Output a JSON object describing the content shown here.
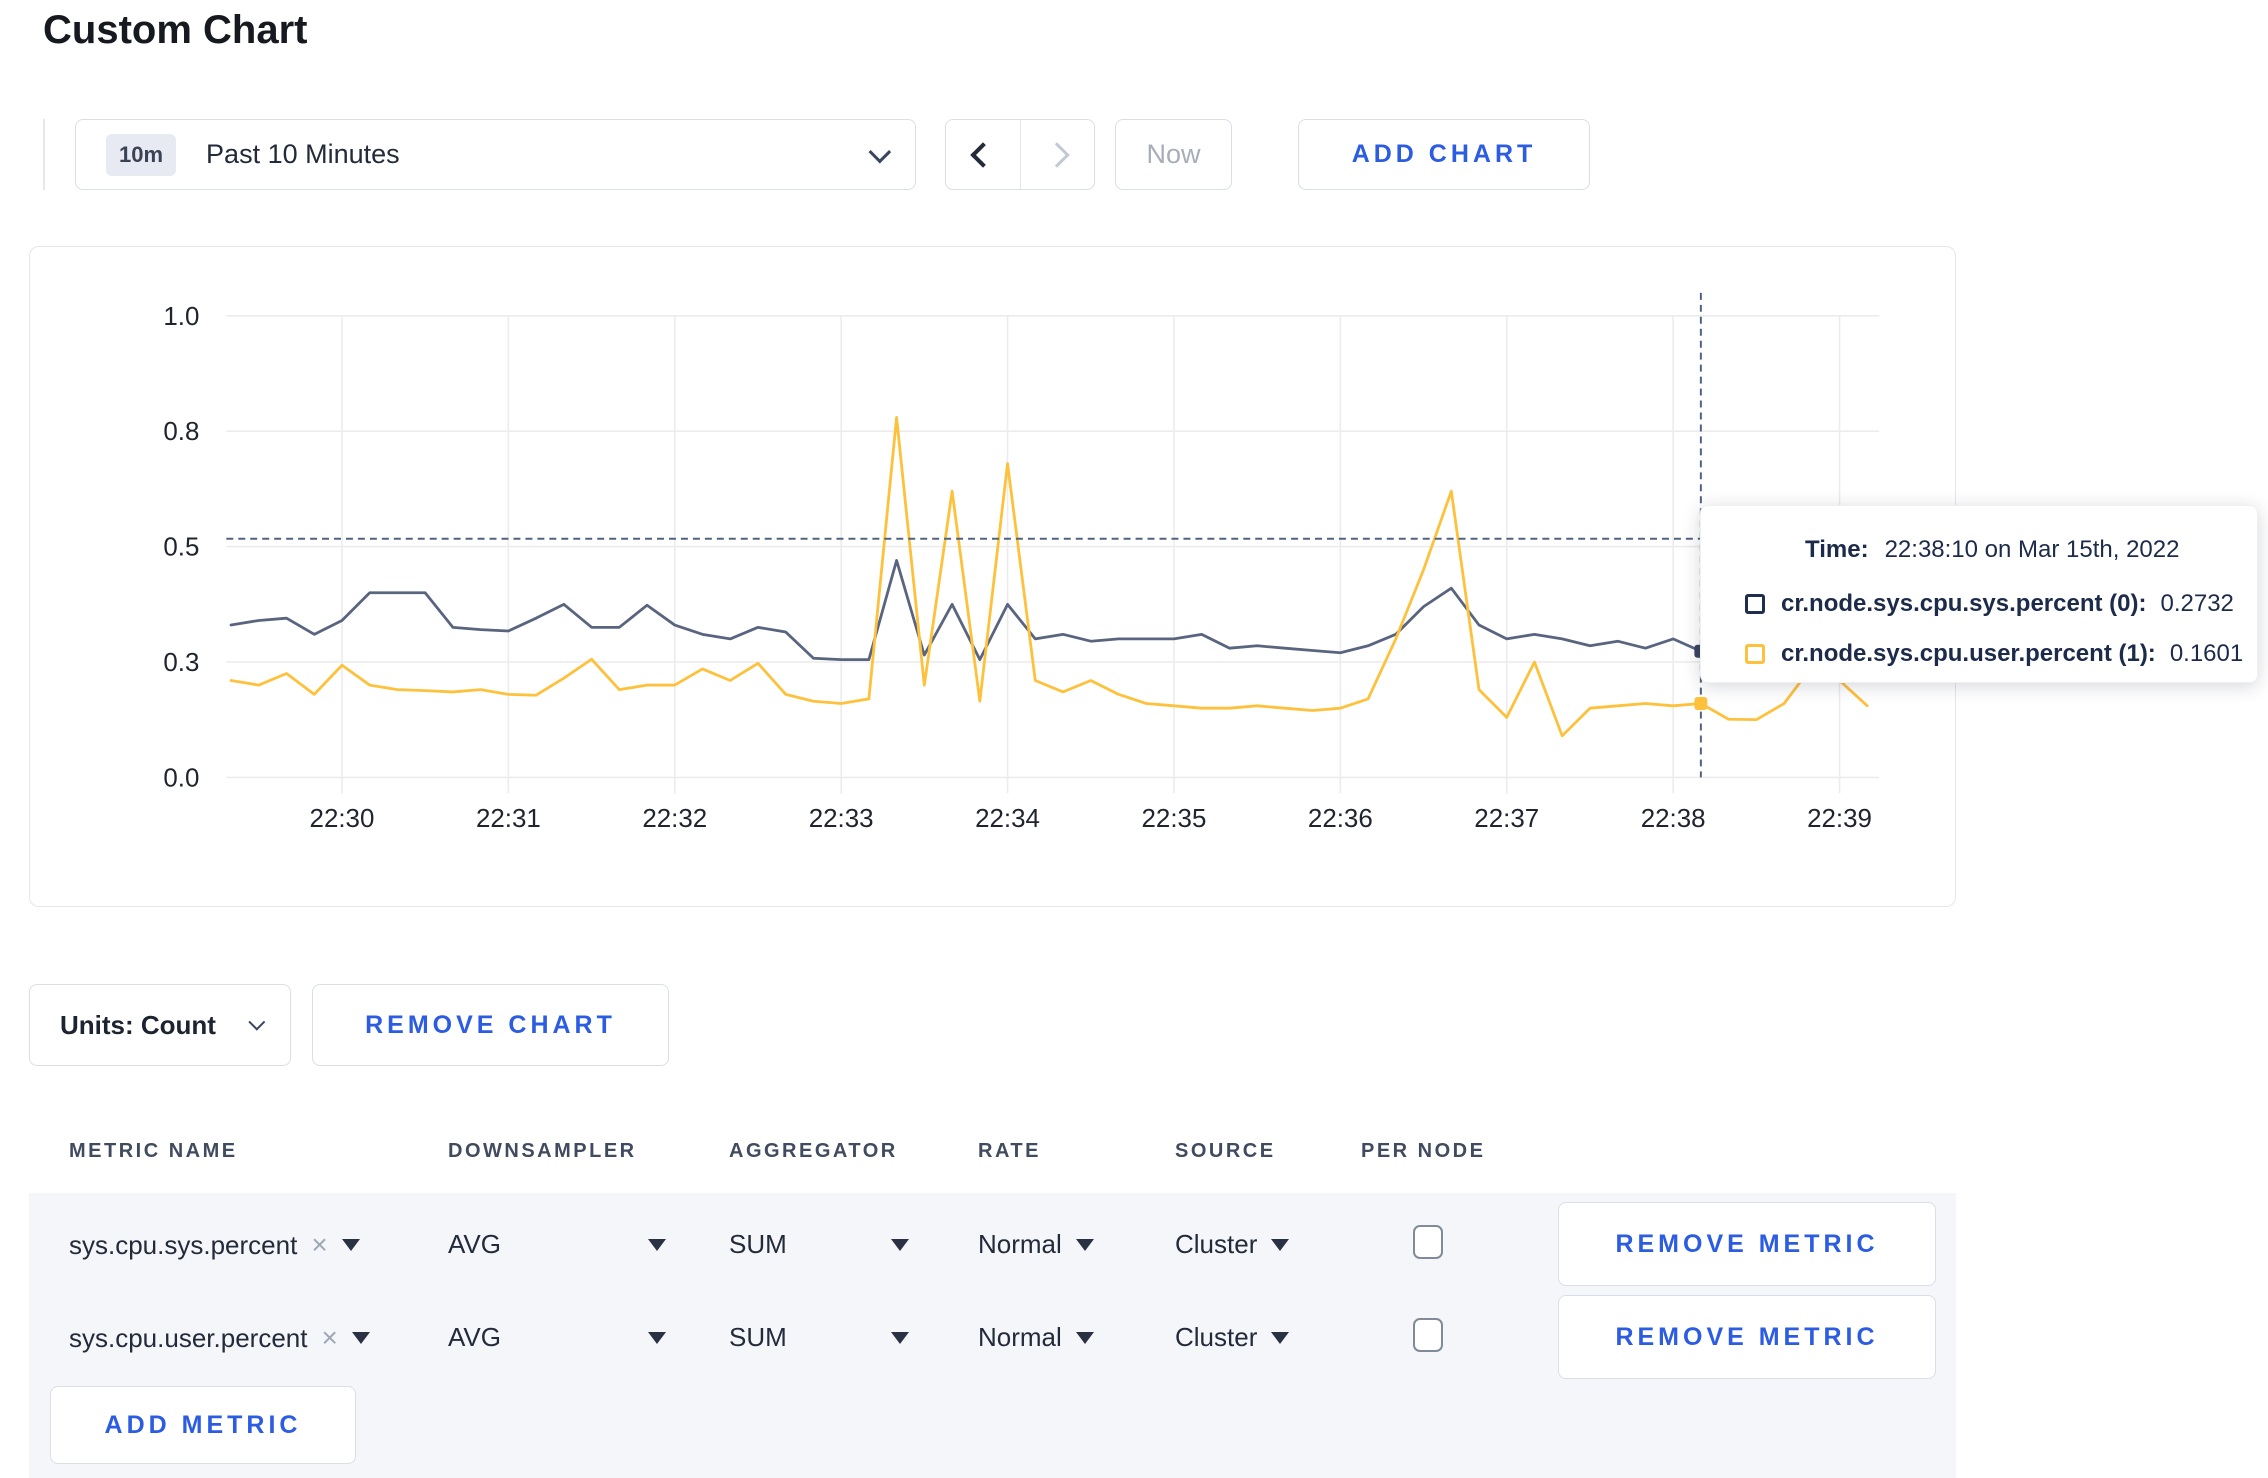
{
  "page": {
    "title": "Custom Chart"
  },
  "toolbar": {
    "time_badge": "10m",
    "time_label": "Past 10 Minutes",
    "now_label": "Now",
    "add_chart_label": "ADD CHART"
  },
  "colors": {
    "accent_blue": "#2b5ce2",
    "series_sys": "#59647f",
    "series_user": "#fdc13c",
    "swatch_sys": "#1f2d4e",
    "swatch_user": "#fdc13c",
    "dot_sys": "#39455f",
    "dot_user": "#fdc13c",
    "gridline": "#ececec",
    "crosshair": "#51637e"
  },
  "chart_data": {
    "type": "line",
    "title": "",
    "xlabel": "",
    "ylabel": "",
    "grid": true,
    "ylim": [
      0,
      1
    ],
    "yticks": [
      {
        "v": 0.0,
        "label": "0.0"
      },
      {
        "v": 0.25,
        "label": "0.3"
      },
      {
        "v": 0.5,
        "label": "0.5"
      },
      {
        "v": 0.75,
        "label": "0.8"
      },
      {
        "v": 1.0,
        "label": "1.0"
      }
    ],
    "xticks": [
      "22:30",
      "22:31",
      "22:32",
      "22:33",
      "22:34",
      "22:35",
      "22:36",
      "22:37",
      "22:38",
      "22:39"
    ],
    "x": [
      "22:29:20",
      "22:29:30",
      "22:29:40",
      "22:29:50",
      "22:30:00",
      "22:30:10",
      "22:30:20",
      "22:30:30",
      "22:30:40",
      "22:30:50",
      "22:31:00",
      "22:31:10",
      "22:31:20",
      "22:31:30",
      "22:31:40",
      "22:31:50",
      "22:32:00",
      "22:32:10",
      "22:32:20",
      "22:32:30",
      "22:32:40",
      "22:32:50",
      "22:33:00",
      "22:33:10",
      "22:33:20",
      "22:33:30",
      "22:33:40",
      "22:33:50",
      "22:34:00",
      "22:34:10",
      "22:34:20",
      "22:34:30",
      "22:34:40",
      "22:34:50",
      "22:35:00",
      "22:35:10",
      "22:35:20",
      "22:35:30",
      "22:35:40",
      "22:35:50",
      "22:36:00",
      "22:36:10",
      "22:36:20",
      "22:36:30",
      "22:36:40",
      "22:36:50",
      "22:37:00",
      "22:37:10",
      "22:37:20",
      "22:37:30",
      "22:37:40",
      "22:37:50",
      "22:38:00",
      "22:38:10",
      "22:38:20",
      "22:38:30",
      "22:38:40",
      "22:38:50",
      "22:39:00",
      "22:39:10"
    ],
    "series": [
      {
        "name": "cr.node.sys.cpu.sys.percent (0)",
        "color": "#59647f",
        "values": [
          0.33,
          0.34,
          0.345,
          0.31,
          0.34,
          0.4,
          0.4,
          0.4,
          0.325,
          0.32,
          0.317,
          0.345,
          0.375,
          0.325,
          0.325,
          0.373,
          0.33,
          0.31,
          0.3,
          0.325,
          0.315,
          0.258,
          0.255,
          0.255,
          0.47,
          0.265,
          0.375,
          0.255,
          0.375,
          0.3,
          0.31,
          0.295,
          0.3,
          0.3,
          0.3,
          0.31,
          0.28,
          0.285,
          0.28,
          0.275,
          0.27,
          0.285,
          0.31,
          0.37,
          0.41,
          0.33,
          0.3,
          0.31,
          0.3,
          0.285,
          0.295,
          0.28,
          0.3,
          0.2732,
          0.28,
          0.285,
          0.29,
          0.3,
          0.305,
          0.3
        ]
      },
      {
        "name": "cr.node.sys.cpu.user.percent (1)",
        "color": "#fdc13c",
        "values": [
          0.21,
          0.2,
          0.225,
          0.18,
          0.243,
          0.2,
          0.19,
          0.188,
          0.185,
          0.19,
          0.18,
          0.178,
          0.215,
          0.256,
          0.19,
          0.2,
          0.2,
          0.235,
          0.21,
          0.247,
          0.18,
          0.165,
          0.16,
          0.17,
          0.78,
          0.2,
          0.62,
          0.165,
          0.68,
          0.21,
          0.185,
          0.21,
          0.18,
          0.16,
          0.155,
          0.15,
          0.15,
          0.155,
          0.15,
          0.145,
          0.15,
          0.17,
          0.3,
          0.45,
          0.62,
          0.19,
          0.13,
          0.25,
          0.09,
          0.15,
          0.155,
          0.16,
          0.155,
          0.1601,
          0.126,
          0.125,
          0.16,
          0.24,
          0.21,
          0.155
        ]
      }
    ],
    "crosshair": {
      "time": "22:38:10",
      "y_value": 0.517,
      "points": [
        {
          "v": 0.2732,
          "color": "#39455f"
        },
        {
          "v": 0.1601,
          "color": "#fdc13c"
        }
      ]
    }
  },
  "tooltip": {
    "time_label": "Time:",
    "time_value": "22:38:10 on Mar 15th, 2022",
    "series": [
      {
        "label": "cr.node.sys.cpu.sys.percent (0):",
        "value": "0.2732",
        "swatch": "#1f2d4e"
      },
      {
        "label": "cr.node.sys.cpu.user.percent (1):",
        "value": "0.1601",
        "swatch": "#fdc13c"
      }
    ]
  },
  "controls": {
    "units_label": "Units: Count",
    "remove_chart_label": "REMOVE CHART"
  },
  "metrics_table": {
    "headers": [
      "METRIC NAME",
      "DOWNSAMPLER",
      "AGGREGATOR",
      "RATE",
      "SOURCE",
      "PER NODE"
    ],
    "clear_icon": "×",
    "rows": [
      {
        "metric": "sys.cpu.sys.percent",
        "downsampler": "AVG",
        "aggregator": "SUM",
        "rate": "Normal",
        "source": "Cluster",
        "per_node_checked": false,
        "remove_label": "REMOVE METRIC"
      },
      {
        "metric": "sys.cpu.user.percent",
        "downsampler": "AVG",
        "aggregator": "SUM",
        "rate": "Normal",
        "source": "Cluster",
        "per_node_checked": false,
        "remove_label": "REMOVE METRIC"
      }
    ],
    "add_metric_label": "ADD METRIC"
  }
}
